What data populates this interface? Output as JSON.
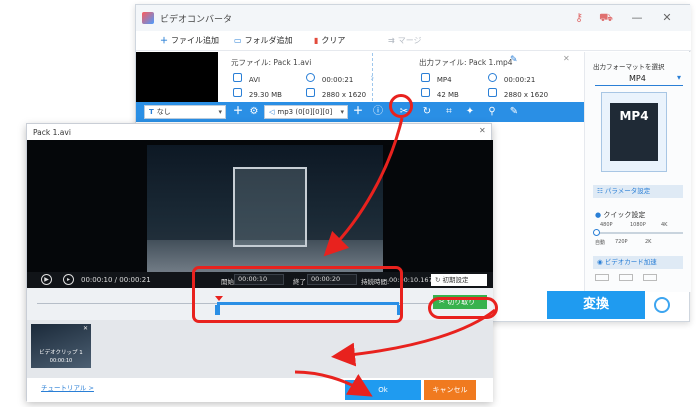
{
  "converter": {
    "title": "ビデオコンバータ",
    "toolbar": {
      "add_file": "ファイル追加",
      "add_folder": "フォルダ追加",
      "clear": "クリア",
      "merge": "マージ"
    },
    "source": {
      "label": "元ファイル: Pack 1.avi",
      "format": "AVI",
      "duration": "00:00:21",
      "size": "29.30 MB",
      "resolution": "2880 x 1620"
    },
    "output": {
      "label": "出力ファイル: Pack 1.mp4",
      "format": "MP4",
      "duration": "00:00:21",
      "size": "42 MB",
      "resolution": "2880 x 1620"
    },
    "subtitle_select": "なし",
    "audio_select": "mp3 (0[0][0][0]",
    "right_panel": {
      "header": "出力フォーマットを選択",
      "format_name": "MP4",
      "params_button": "パラメータ設定",
      "quick_settings": "クイック設定",
      "scale_top": [
        "480P",
        "1080P",
        "4K"
      ],
      "scale_bottom": [
        "自動",
        "720P",
        "2K"
      ],
      "gpu_accel": "ビデオカード加速"
    },
    "convert_label": "変換"
  },
  "editor": {
    "title": "Pack 1.avi",
    "time_current": "00:00:10",
    "time_total": "00:00:21",
    "start_label": "開始",
    "start_value": "00:00:10",
    "end_label": "終了",
    "end_value": "00:00:20",
    "duration_label": "持続時間:",
    "duration_value": "00:00:10.167",
    "reset_button": "初期設定",
    "cut_button": "切り取り",
    "clip_label": "ビデオクリップ 1",
    "clip_time": "00:00:10",
    "tutorial_link": "チュートリアル >",
    "ok_button": "Ok",
    "cancel_button": "キャンセル"
  },
  "colors": {
    "accent_blue": "#2a8fe5",
    "highlight_red": "#e8221e",
    "cut_green": "#37b24d",
    "cancel_orange": "#f07a1f"
  }
}
